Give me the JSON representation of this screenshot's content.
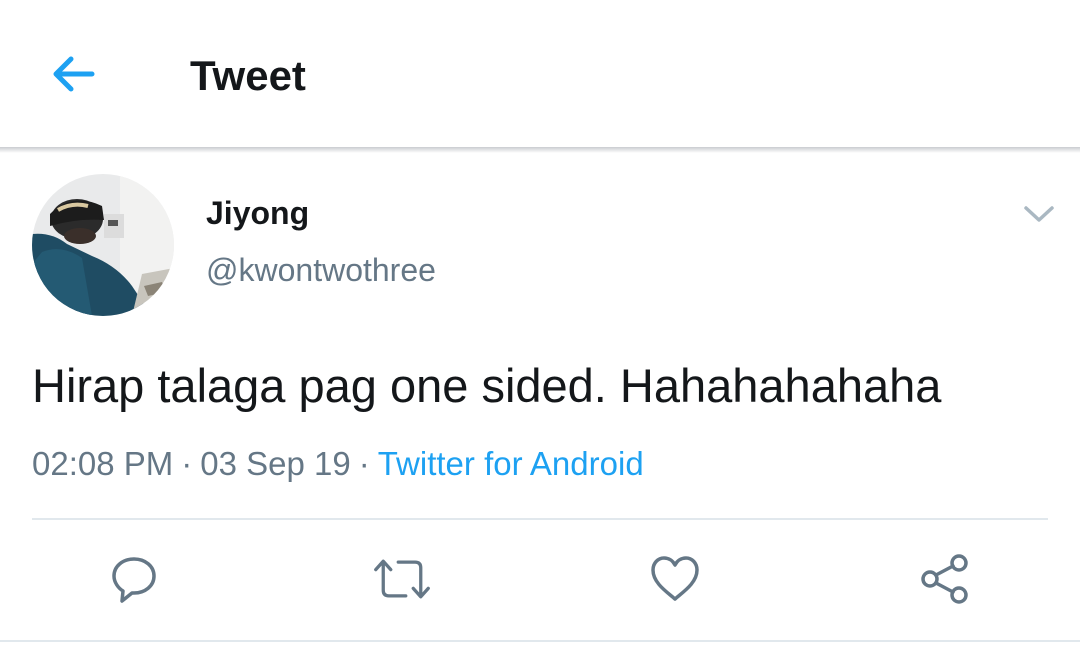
{
  "header": {
    "title": "Tweet",
    "back_icon": "arrow-left-icon",
    "accent_color": "#1da1f2"
  },
  "tweet": {
    "author": {
      "name": "Jiyong",
      "handle": "@kwontwothree",
      "avatar": "user-photo"
    },
    "text": "Hirap talaga pag one sided. Hahahahahaha",
    "time": "02:08 PM",
    "date": "03 Sep 19",
    "separator": "·",
    "source": "Twitter for Android",
    "menu_icon": "chevron-down-icon"
  },
  "actions": [
    {
      "name": "reply",
      "icon": "reply-icon"
    },
    {
      "name": "retweet",
      "icon": "retweet-icon"
    },
    {
      "name": "like",
      "icon": "heart-icon"
    },
    {
      "name": "share",
      "icon": "share-icon"
    }
  ]
}
